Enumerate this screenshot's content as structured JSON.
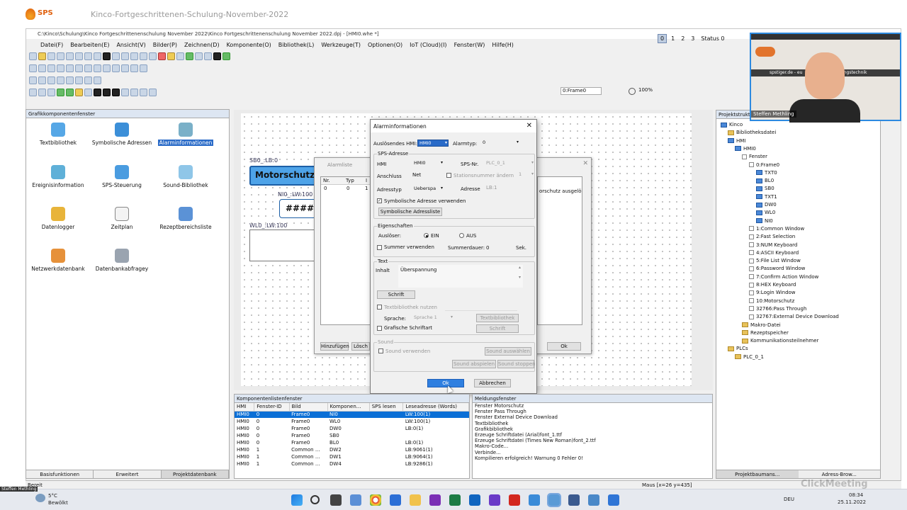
{
  "header": {
    "brand": "SPS",
    "video_title": "Kinco-Fortgeschrittenen-Schulung-November-2022"
  },
  "window": {
    "title": "C:\\Kinco\\Schulung\\Kinco Fortgeschrittenenschulung November 2022\\Kinco Fortgeschrittenenschulung November 2022.dpj - [HMI0.whe *]",
    "menu": [
      "Datei(F)",
      "Bearbeiten(E)",
      "Ansicht(V)",
      "Bilder(P)",
      "Zeichnen(D)",
      "Komponente(O)",
      "Bibliothek(L)",
      "Werkzeuge(T)",
      "Optionen(O)",
      "IoT (Cloud)(I)",
      "Fenster(W)",
      "Hilfe(H)"
    ],
    "frame_tabs": [
      "0",
      "1",
      "2",
      "3"
    ],
    "frame_status": "Status 0",
    "frame_combo": "0:Frame0",
    "zoom": "100%"
  },
  "left_panel": {
    "title": "Grafikkomponentenfenster",
    "items": [
      "Textbibliothek",
      "Symbolische Adressen",
      "Alarminformationen",
      "Ereignisinformation",
      "SPS-Steuerung",
      "Sound-Bibliothek",
      "Datenlogger",
      "Zeitplan",
      "Rezeptbereichsliste",
      "Netzwerkdatenbank",
      "Datenbankabfragey"
    ],
    "selected": "Alarminformationen",
    "tabs": [
      "Basisfunktionen",
      "Erweitert",
      "Projektdatenbank"
    ]
  },
  "canvas": {
    "sb_label": "SB0_:LB:0",
    "button_text": "Motorschutz a",
    "ni_label": "NI0_:LW:100",
    "num_text": "####",
    "wl_label": "WL0_:LW:100"
  },
  "alarm_list": {
    "title": "Alarmliste",
    "cols": [
      "Nr.",
      "Typ",
      "I"
    ],
    "row": [
      "0",
      "0",
      "1"
    ],
    "side_text": "orschutz ausgelö",
    "btn_add": "Hinzufügen",
    "btn_del": "Lösch",
    "btn_ok": "Ok"
  },
  "dialog": {
    "title": "Alarminformationen",
    "trigger_hmi_label": "Auslösendes HMI:",
    "trigger_hmi_value": "HMI0",
    "alarm_type_label": "Alarmtyp:",
    "alarm_type_value": "0",
    "plc_address_group": "SPS-Adresse",
    "hmi_label": "HMI",
    "hmi_value": "HMI0",
    "plc_no_label": "SPS-Nr.",
    "plc_no_value": "PLC_0_1",
    "connection_label": "Anschluss",
    "connection_value": "Net",
    "station_label": "Stationsnummer ändern",
    "station_value": "1",
    "addrtype_label": "Adresstyp",
    "addrtype_value": "Ueberspa",
    "address_label": "Adresse",
    "address_value": "LB:1",
    "use_symbolic": "Symbolische Adresse verwenden",
    "symbolic_list_btn": "Symbolische Adressliste",
    "props_group": "Eigenschaften",
    "trigger_label": "Auslöser:",
    "on_label": "EIN",
    "off_label": "AUS",
    "buzzer_label": "Summer verwenden",
    "buzzer_duration_label": "Summerdauer:",
    "buzzer_duration_value": "0",
    "sec_label": "Sek.",
    "text_group": "Text",
    "content_label": "Inhalt",
    "content_value": "Überspannung",
    "font_btn": "Schrift",
    "textlib_use": "Textbibliothek nutzen",
    "language_label": "Sprache:",
    "language_value": "Sprache 1",
    "textlib_btn": "Textbibliothek",
    "graphic_font": "Grafische Schriftart",
    "font_btn2": "Schrift",
    "sound_group": "Sound",
    "sound_use": "Sound verwenden",
    "sound_select_btn": "Sound auswählen",
    "sound_play_btn": "Sound abspielen",
    "sound_stop_btn": "Sound stoppen",
    "ok_btn": "Ok",
    "cancel_btn": "Abbrechen"
  },
  "project_tree": {
    "title": "Projektstruktur",
    "items": [
      {
        "t": "Kinco",
        "d": 0,
        "k": "mon"
      },
      {
        "t": "Bibliotheksdatei",
        "d": 1,
        "k": "fld"
      },
      {
        "t": "HMI",
        "d": 1,
        "k": "mon"
      },
      {
        "t": "HMI0",
        "d": 2,
        "k": "mon"
      },
      {
        "t": "Fenster",
        "d": 3,
        "k": "doc"
      },
      {
        "t": "0:Frame0",
        "d": 4,
        "k": "doc"
      },
      {
        "t": "TXT0",
        "d": 5,
        "k": "mon"
      },
      {
        "t": "BL0",
        "d": 5,
        "k": "mon"
      },
      {
        "t": "SB0",
        "d": 5,
        "k": "mon"
      },
      {
        "t": "TXT1",
        "d": 5,
        "k": "mon"
      },
      {
        "t": "DW0",
        "d": 5,
        "k": "mon"
      },
      {
        "t": "WL0",
        "d": 5,
        "k": "mon"
      },
      {
        "t": "NI0",
        "d": 5,
        "k": "mon"
      },
      {
        "t": "1:Common Window",
        "d": 4,
        "k": "doc"
      },
      {
        "t": "2:Fast Selection",
        "d": 4,
        "k": "doc"
      },
      {
        "t": "3:NUM Keyboard",
        "d": 4,
        "k": "doc"
      },
      {
        "t": "4:ASCII Keyboard",
        "d": 4,
        "k": "doc"
      },
      {
        "t": "5:File List Window",
        "d": 4,
        "k": "doc"
      },
      {
        "t": "6:Password Window",
        "d": 4,
        "k": "doc"
      },
      {
        "t": "7:Confirm Action Window",
        "d": 4,
        "k": "doc"
      },
      {
        "t": "8:HEX Keyboard",
        "d": 4,
        "k": "doc"
      },
      {
        "t": "9:Login Window",
        "d": 4,
        "k": "doc"
      },
      {
        "t": "10:Motorschutz",
        "d": 4,
        "k": "doc"
      },
      {
        "t": "32766:Pass Through",
        "d": 4,
        "k": "doc"
      },
      {
        "t": "32767:External Device Download",
        "d": 4,
        "k": "doc"
      },
      {
        "t": "Makro-Datei",
        "d": 3,
        "k": "fld"
      },
      {
        "t": "Rezeptspeicher",
        "d": 3,
        "k": "fld"
      },
      {
        "t": "Kommunikationsteilnehmer",
        "d": 3,
        "k": "fld"
      },
      {
        "t": "PLCs",
        "d": 1,
        "k": "fld"
      },
      {
        "t": "PLC_0_1",
        "d": 2,
        "k": "fld"
      }
    ],
    "tabs": [
      "Projektbaumans...",
      "Adress-Brow..."
    ]
  },
  "component_list": {
    "title": "Komponentenlistenfenster",
    "headers": [
      "HMI",
      "Fenster-ID",
      "Bild",
      "Komponen...",
      "SPS lesen",
      "Leseadresse (Words)"
    ],
    "rows": [
      [
        "HMI0",
        "0",
        "Frame0",
        "NI0",
        "",
        "LW:100(1)"
      ],
      [
        "HMI0",
        "0",
        "Frame0",
        "WL0",
        "",
        "LW:100(1)"
      ],
      [
        "HMI0",
        "0",
        "Frame0",
        "DW0",
        "",
        "LB:0(1)"
      ],
      [
        "HMI0",
        "0",
        "Frame0",
        "SB0",
        "",
        ""
      ],
      [
        "HMI0",
        "0",
        "Frame0",
        "BL0",
        "",
        "LB:0(1)"
      ],
      [
        "HMI0",
        "1",
        "Common ...",
        "DW2",
        "",
        "LB:9061(1)"
      ],
      [
        "HMI0",
        "1",
        "Common ...",
        "DW1",
        "",
        "LB:9064(1)"
      ],
      [
        "HMI0",
        "1",
        "Common ...",
        "DW4",
        "",
        "LB:9286(1)"
      ]
    ],
    "selected_row": 0
  },
  "messages": {
    "title": "Meldungsfenster",
    "lines": [
      "Fenster Motorschutz",
      "Fenster Pass Through",
      "Fenster External Device Download",
      "Textbibliothek",
      "Grafikbibliothek",
      "Erzeuge Schriftdatei (Arial)font_1.ttf",
      "Erzeuge Schriftdatei (Times New Roman)font_2.ttf",
      "Makro-Code...",
      "Verbinde...",
      "Kompilieren erfolgreich! Warnung 0 Fehler 0!"
    ]
  },
  "statusbar": {
    "left": "Bereit",
    "mouse": "Maus [x=26  y=435]"
  },
  "webcam": {
    "name": "Steffen Methling",
    "url_text": "spstiger.de - eu",
    "banner_text": "tomatisierungstechnik"
  },
  "taskbar": {
    "temp": "5°C",
    "weather": "Bewölkt",
    "lang": "DEU",
    "time": "08:34",
    "date": "25.11.2022",
    "bottom_left_name": "Steffen Methling"
  },
  "watermark": "ClickMeeting",
  "colors": {
    "accent": "#2a6bc8",
    "selection": "#0b6fd6",
    "brand": "#e0600e"
  }
}
